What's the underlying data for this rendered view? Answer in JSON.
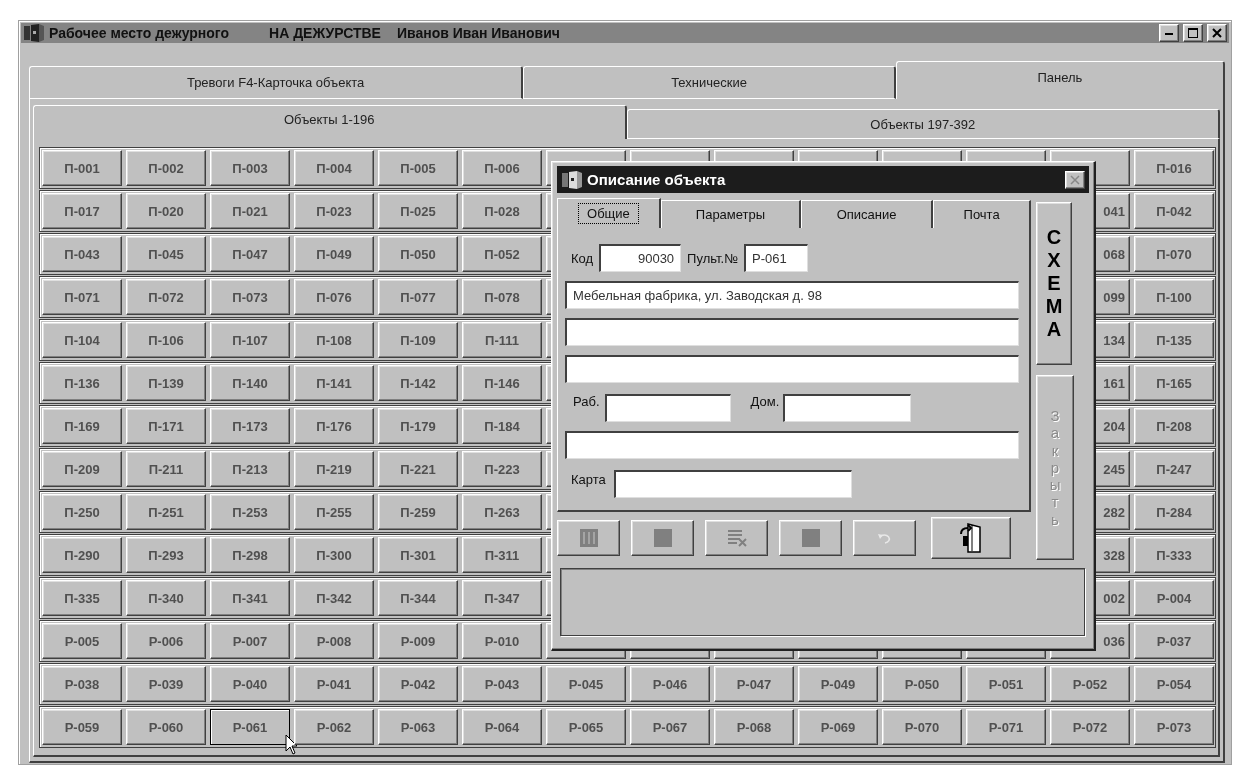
{
  "window": {
    "title": "Рабочее место дежурного",
    "status": "НА ДЕЖУРСТВЕ",
    "user": "Иванов Иван Иванович"
  },
  "tabs": [
    {
      "label": "Тревоги F4-Карточка объекта",
      "selected": false
    },
    {
      "label": "Технические",
      "selected": false
    },
    {
      "label": "Панель",
      "selected": true
    }
  ],
  "subtabs": [
    {
      "label": "Объекты 1-196",
      "selected": true
    },
    {
      "label": "Объекты 197-392",
      "selected": false
    }
  ],
  "grid": {
    "rows": [
      {
        "left": [
          {
            "label": "П-001",
            "kind": "full",
            "focused": false
          },
          {
            "label": "П-002",
            "kind": "full",
            "focused": false
          },
          {
            "label": "П-003",
            "kind": "full",
            "focused": false
          },
          {
            "label": "П-004",
            "kind": "full",
            "focused": false
          },
          {
            "label": "П-005",
            "kind": "full",
            "focused": false
          },
          {
            "label": "П-006",
            "kind": "full",
            "focused": false
          }
        ],
        "right": [
          {
            "label": "П-016",
            "kind": "full",
            "focused": false
          }
        ]
      },
      {
        "left": [
          {
            "label": "П-017",
            "kind": "full",
            "focused": false
          },
          {
            "label": "П-020",
            "kind": "full",
            "focused": false
          },
          {
            "label": "П-021",
            "kind": "full",
            "focused": false
          },
          {
            "label": "П-023",
            "kind": "full",
            "focused": false
          },
          {
            "label": "П-025",
            "kind": "full",
            "focused": false
          },
          {
            "label": "П-028",
            "kind": "full",
            "focused": false
          }
        ],
        "right": [
          {
            "label": "041",
            "kind": "partial",
            "focused": false
          },
          {
            "label": "П-042",
            "kind": "full",
            "focused": false
          }
        ]
      },
      {
        "left": [
          {
            "label": "П-043",
            "kind": "full",
            "focused": false
          },
          {
            "label": "П-045",
            "kind": "full",
            "focused": false
          },
          {
            "label": "П-047",
            "kind": "full",
            "focused": false
          },
          {
            "label": "П-049",
            "kind": "full",
            "focused": false
          },
          {
            "label": "П-050",
            "kind": "full",
            "focused": false
          },
          {
            "label": "П-052",
            "kind": "full",
            "focused": false
          }
        ],
        "right": [
          {
            "label": "068",
            "kind": "partial",
            "focused": false
          },
          {
            "label": "П-070",
            "kind": "full",
            "focused": false
          }
        ]
      },
      {
        "left": [
          {
            "label": "П-071",
            "kind": "full",
            "focused": false
          },
          {
            "label": "П-072",
            "kind": "full",
            "focused": false
          },
          {
            "label": "П-073",
            "kind": "full",
            "focused": false
          },
          {
            "label": "П-076",
            "kind": "full",
            "focused": false
          },
          {
            "label": "П-077",
            "kind": "full",
            "focused": false
          },
          {
            "label": "П-078",
            "kind": "full",
            "focused": false
          }
        ],
        "right": [
          {
            "label": "099",
            "kind": "partial",
            "focused": false
          },
          {
            "label": "П-100",
            "kind": "full",
            "focused": false
          }
        ]
      },
      {
        "left": [
          {
            "label": "П-104",
            "kind": "full",
            "focused": false
          },
          {
            "label": "П-106",
            "kind": "full",
            "focused": false
          },
          {
            "label": "П-107",
            "kind": "full",
            "focused": false
          },
          {
            "label": "П-108",
            "kind": "full",
            "focused": false
          },
          {
            "label": "П-109",
            "kind": "full",
            "focused": false
          },
          {
            "label": "П-111",
            "kind": "full",
            "focused": false
          }
        ],
        "right": [
          {
            "label": "134",
            "kind": "partial",
            "focused": false
          },
          {
            "label": "П-135",
            "kind": "full",
            "focused": false
          }
        ]
      },
      {
        "left": [
          {
            "label": "П-136",
            "kind": "full",
            "focused": false
          },
          {
            "label": "П-139",
            "kind": "full",
            "focused": false
          },
          {
            "label": "П-140",
            "kind": "full",
            "focused": false
          },
          {
            "label": "П-141",
            "kind": "full",
            "focused": false
          },
          {
            "label": "П-142",
            "kind": "full",
            "focused": false
          },
          {
            "label": "П-146",
            "kind": "full",
            "focused": false
          }
        ],
        "right": [
          {
            "label": "161",
            "kind": "partial",
            "focused": false
          },
          {
            "label": "П-165",
            "kind": "full",
            "focused": false
          }
        ]
      },
      {
        "left": [
          {
            "label": "П-169",
            "kind": "full",
            "focused": false
          },
          {
            "label": "П-171",
            "kind": "full",
            "focused": false
          },
          {
            "label": "П-173",
            "kind": "full",
            "focused": false
          },
          {
            "label": "П-176",
            "kind": "full",
            "focused": false
          },
          {
            "label": "П-179",
            "kind": "full",
            "focused": false
          },
          {
            "label": "П-184",
            "kind": "full",
            "focused": false
          }
        ],
        "right": [
          {
            "label": "204",
            "kind": "partial",
            "focused": false
          },
          {
            "label": "П-208",
            "kind": "full",
            "focused": false
          }
        ]
      },
      {
        "left": [
          {
            "label": "П-209",
            "kind": "full",
            "focused": false
          },
          {
            "label": "П-211",
            "kind": "full",
            "focused": false
          },
          {
            "label": "П-213",
            "kind": "full",
            "focused": false
          },
          {
            "label": "П-219",
            "kind": "full",
            "focused": false
          },
          {
            "label": "П-221",
            "kind": "full",
            "focused": false
          },
          {
            "label": "П-223",
            "kind": "full",
            "focused": false
          }
        ],
        "right": [
          {
            "label": "245",
            "kind": "partial",
            "focused": false
          },
          {
            "label": "П-247",
            "kind": "full",
            "focused": false
          }
        ]
      },
      {
        "left": [
          {
            "label": "П-250",
            "kind": "full",
            "focused": false
          },
          {
            "label": "П-251",
            "kind": "full",
            "focused": false
          },
          {
            "label": "П-253",
            "kind": "full",
            "focused": false
          },
          {
            "label": "П-255",
            "kind": "full",
            "focused": false
          },
          {
            "label": "П-259",
            "kind": "full",
            "focused": false
          },
          {
            "label": "П-263",
            "kind": "full",
            "focused": false
          }
        ],
        "right": [
          {
            "label": "282",
            "kind": "partial",
            "focused": false
          },
          {
            "label": "П-284",
            "kind": "full",
            "focused": false
          }
        ]
      },
      {
        "left": [
          {
            "label": "П-290",
            "kind": "full",
            "focused": false
          },
          {
            "label": "П-293",
            "kind": "full",
            "focused": false
          },
          {
            "label": "П-298",
            "kind": "full",
            "focused": false
          },
          {
            "label": "П-300",
            "kind": "full",
            "focused": false
          },
          {
            "label": "П-301",
            "kind": "full",
            "focused": false
          },
          {
            "label": "П-311",
            "kind": "full",
            "focused": false
          }
        ],
        "right": [
          {
            "label": "328",
            "kind": "partial",
            "focused": false
          },
          {
            "label": "П-333",
            "kind": "full",
            "focused": false
          }
        ]
      },
      {
        "left": [
          {
            "label": "П-335",
            "kind": "full",
            "focused": false
          },
          {
            "label": "П-340",
            "kind": "full",
            "focused": false
          },
          {
            "label": "П-341",
            "kind": "full",
            "focused": false
          },
          {
            "label": "П-342",
            "kind": "full",
            "focused": false
          },
          {
            "label": "П-344",
            "kind": "full",
            "focused": false
          },
          {
            "label": "П-347",
            "kind": "full",
            "focused": false
          }
        ],
        "right": [
          {
            "label": "002",
            "kind": "partial",
            "focused": false
          },
          {
            "label": "Р-004",
            "kind": "full",
            "focused": false
          }
        ]
      },
      {
        "left": [
          {
            "label": "Р-005",
            "kind": "full",
            "focused": false
          },
          {
            "label": "Р-006",
            "kind": "full",
            "focused": false
          },
          {
            "label": "Р-007",
            "kind": "full",
            "focused": false
          },
          {
            "label": "Р-008",
            "kind": "full",
            "focused": false
          },
          {
            "label": "Р-009",
            "kind": "full",
            "focused": false
          },
          {
            "label": "Р-010",
            "kind": "full",
            "focused": false
          }
        ],
        "right": [
          {
            "label": "036",
            "kind": "partial",
            "focused": false
          },
          {
            "label": "Р-037",
            "kind": "full",
            "focused": false
          }
        ]
      },
      {
        "left": [
          {
            "label": "Р-038",
            "kind": "full",
            "focused": false
          },
          {
            "label": "Р-039",
            "kind": "full",
            "focused": false
          },
          {
            "label": "Р-040",
            "kind": "full",
            "focused": false
          },
          {
            "label": "Р-041",
            "kind": "full",
            "focused": false
          },
          {
            "label": "Р-042",
            "kind": "full",
            "focused": false
          },
          {
            "label": "Р-043",
            "kind": "full",
            "focused": false
          },
          {
            "label": "Р-045",
            "kind": "full",
            "focused": false
          },
          {
            "label": "Р-046",
            "kind": "full",
            "focused": false
          },
          {
            "label": "Р-047",
            "kind": "full",
            "focused": false
          },
          {
            "label": "Р-049",
            "kind": "full",
            "focused": false
          },
          {
            "label": "Р-050",
            "kind": "full",
            "focused": false
          },
          {
            "label": "Р-051",
            "kind": "full",
            "focused": false
          },
          {
            "label": "Р-052",
            "kind": "full",
            "focused": false
          },
          {
            "label": "Р-054",
            "kind": "full",
            "focused": false
          }
        ]
      },
      {
        "left": [
          {
            "label": "Р-059",
            "kind": "full",
            "focused": false
          },
          {
            "label": "Р-060",
            "kind": "full",
            "focused": false
          },
          {
            "label": "Р-061",
            "kind": "full",
            "focused": true
          },
          {
            "label": "Р-062",
            "kind": "full",
            "focused": false
          },
          {
            "label": "Р-063",
            "kind": "full",
            "focused": false
          },
          {
            "label": "Р-064",
            "kind": "full",
            "focused": false
          },
          {
            "label": "Р-065",
            "kind": "full",
            "focused": false
          },
          {
            "label": "Р-067",
            "kind": "full",
            "focused": false
          },
          {
            "label": "Р-068",
            "kind": "full",
            "focused": false
          },
          {
            "label": "Р-069",
            "kind": "full",
            "focused": false
          },
          {
            "label": "Р-070",
            "kind": "full",
            "focused": false
          },
          {
            "label": "Р-071",
            "kind": "full",
            "focused": false
          },
          {
            "label": "Р-072",
            "kind": "full",
            "focused": false
          },
          {
            "label": "Р-073",
            "kind": "full",
            "focused": false
          }
        ]
      }
    ]
  },
  "dialog": {
    "title": "Описание объекта",
    "tabs": [
      {
        "label": "Общие",
        "selected": true
      },
      {
        "label": "Параметры",
        "selected": false
      },
      {
        "label": "Описание",
        "selected": false
      },
      {
        "label": "Почта",
        "selected": false
      }
    ],
    "code": {
      "label": "Код",
      "value": "90030"
    },
    "console": {
      "label": "Пульт.№",
      "value": "Р-061"
    },
    "address": {
      "value": "Мебельная фабрика, ул. Заводская д. 98"
    },
    "work_phone": {
      "label": "Раб."
    },
    "home_phone": {
      "label": "Дом."
    },
    "map": {
      "label": "Карта"
    },
    "scheme_button": {
      "label": "СХЕМА",
      "disabled": false
    },
    "close_button": {
      "label": "Закрыть",
      "disabled": true
    },
    "toolbar": [
      {
        "kind": "grid",
        "disabled": true
      },
      {
        "kind": "square",
        "disabled": true
      },
      {
        "kind": "delete",
        "disabled": true
      },
      {
        "kind": "square",
        "disabled": true
      },
      {
        "kind": "undo",
        "disabled": true
      },
      {
        "kind": "exit",
        "disabled": false
      }
    ]
  }
}
